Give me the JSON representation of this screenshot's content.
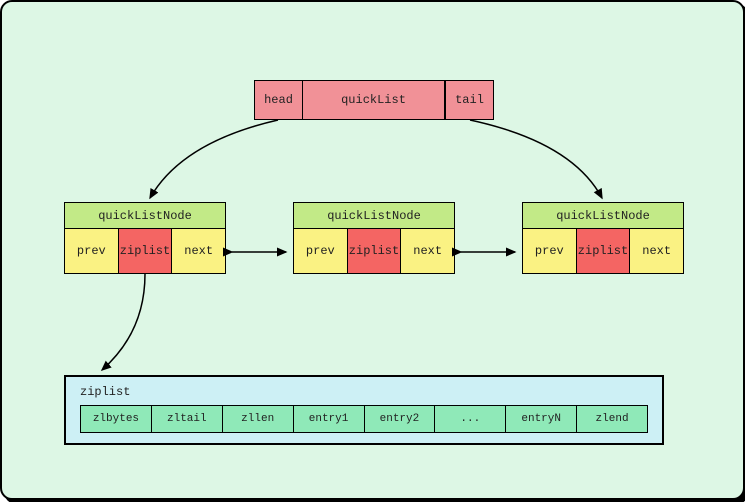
{
  "quicklist": {
    "head": "head",
    "title": "quickList",
    "tail": "tail"
  },
  "node": {
    "title": "quickListNode",
    "prev": "prev",
    "ziplist": "ziplist",
    "next": "next"
  },
  "zipbox": {
    "label": "ziplist",
    "cells": {
      "c0": "zlbytes",
      "c1": "zltail",
      "c2": "zllen",
      "c3": "entry1",
      "c4": "entry2",
      "c5": "...",
      "c6": "entryN",
      "c7": "zlend"
    }
  }
}
